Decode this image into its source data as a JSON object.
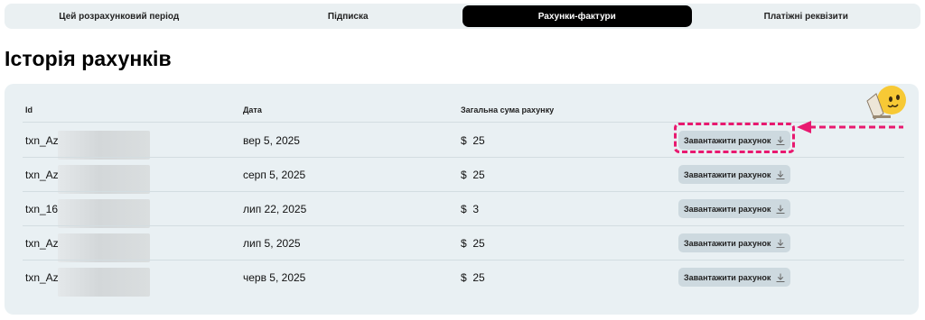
{
  "tabs": [
    {
      "label": "Цей розрахунковий період",
      "active": false
    },
    {
      "label": "Підписка",
      "active": false
    },
    {
      "label": "Рахунки-фактури",
      "active": true
    },
    {
      "label": "Платіжні реквізити",
      "active": false
    }
  ],
  "page": {
    "title": "Історія рахунків"
  },
  "table": {
    "columns": [
      "Id",
      "Дата",
      "Загальна сума рахунку"
    ],
    "rows": [
      {
        "id": "txn_Az",
        "date": "вер 5, 2025",
        "currency": "$",
        "amount": "25",
        "button": "Завантажити рахунок"
      },
      {
        "id": "txn_Az",
        "date": "серп 5, 2025",
        "currency": "$",
        "amount": "25",
        "button": "Завантажити рахунок"
      },
      {
        "id": "txn_169",
        "date": "лип 22, 2025",
        "currency": "$",
        "amount": "3",
        "button": "Завантажити рахунок"
      },
      {
        "id": "txn_Az",
        "date": "лип 5, 2025",
        "currency": "$",
        "amount": "25",
        "button": "Завантажити рахунок"
      },
      {
        "id": "txn_Az",
        "date": "черв 5, 2025",
        "currency": "$",
        "amount": "25",
        "button": "Завантажити рахунок"
      }
    ]
  },
  "colors": {
    "accent": "#000000",
    "highlight": "#e8196f",
    "card": "#e9f0f3",
    "button": "#cdd9df"
  },
  "icons": {
    "download": "download-icon",
    "mascot": "smiley-laptop-icon"
  }
}
